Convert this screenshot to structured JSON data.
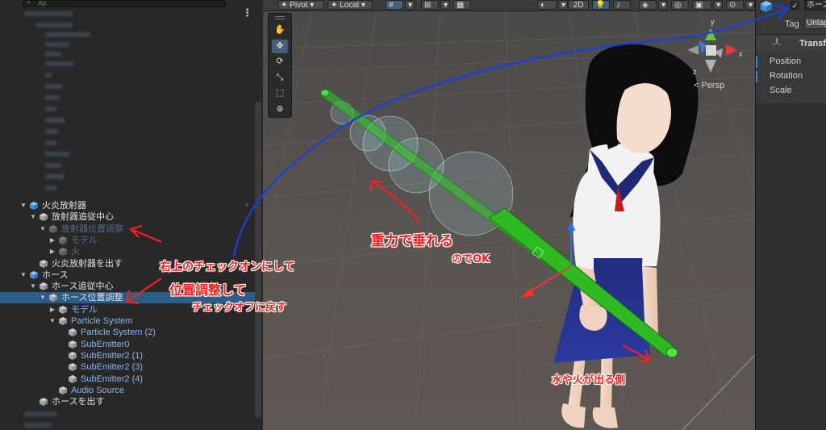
{
  "hierarchy": {
    "search_placeholder": "All",
    "items": [
      {
        "label": "火炎放射器",
        "level": 1,
        "expanded": true,
        "color": "white",
        "prefab": true
      },
      {
        "label": "放射器追従中心",
        "level": 2,
        "expanded": true,
        "color": "white"
      },
      {
        "label": "放射器位置調整",
        "level": 3,
        "expanded": true,
        "color": "dim"
      },
      {
        "label": "モデル",
        "level": 4,
        "expanded": false,
        "color": "dim"
      },
      {
        "label": "火",
        "level": 4,
        "expanded": false,
        "color": "dim"
      },
      {
        "label": "火炎放射器を出す",
        "level": 2,
        "expanded": null,
        "color": "white"
      },
      {
        "label": "ホース",
        "level": 1,
        "expanded": true,
        "color": "white",
        "prefab": true
      },
      {
        "label": "ホース追従中心",
        "level": 2,
        "expanded": true,
        "color": "white"
      },
      {
        "label": "ホース位置調整",
        "level": 3,
        "expanded": true,
        "color": "white",
        "selected": true
      },
      {
        "label": "モデル",
        "level": 4,
        "expanded": false,
        "color": "blue"
      },
      {
        "label": "Particle System",
        "level": 4,
        "expanded": true,
        "color": "blue"
      },
      {
        "label": "Particle System (2)",
        "level": 5,
        "expanded": null,
        "color": "blue"
      },
      {
        "label": "SubEmitter0",
        "level": 5,
        "expanded": null,
        "color": "blue"
      },
      {
        "label": "SubEmitter2 (1)",
        "level": 5,
        "expanded": null,
        "color": "blue"
      },
      {
        "label": "SubEmitter2 (3)",
        "level": 5,
        "expanded": null,
        "color": "blue"
      },
      {
        "label": "SubEmitter2 (4)",
        "level": 5,
        "expanded": null,
        "color": "blue"
      },
      {
        "label": "Audio Source",
        "level": 4,
        "expanded": null,
        "color": "blue"
      },
      {
        "label": "ホースを出す",
        "level": 2,
        "expanded": null,
        "color": "white"
      }
    ]
  },
  "scene": {
    "toolbar": {
      "pivot": "Pivot",
      "local": "Local",
      "mode_2d": "2D"
    },
    "tools": [
      "hand-tool",
      "move-tool",
      "rotate-tool",
      "scale-tool",
      "rect-tool",
      "transform-tool"
    ],
    "tool_glyphs": [
      "✋",
      "✥",
      "⟳",
      "⤡",
      "⬚",
      "⊛"
    ],
    "gizmo": {
      "x": "x",
      "y": "y",
      "z": "z",
      "projection": "< Persp"
    }
  },
  "inspector": {
    "object_name": "ホース",
    "tag_label": "Tag",
    "tag_value": "Untagged",
    "component": "Transform",
    "properties": [
      "Position",
      "Rotation",
      "Scale"
    ]
  },
  "annotations": {
    "note_topright": "右上のチェックオンにして",
    "note_adjust": "位置調整して",
    "note_checkoff": "チェックオフに戻す",
    "note_gravity": "重力で垂れる",
    "note_ok": "のでOK",
    "note_water": "水や火が出る側"
  },
  "colors": {
    "hierarchy_bg": "#282828",
    "selection": "#2c5d87",
    "scene_bg": "#3a3a3a",
    "hose": "#3fcc2a",
    "annotation_red": "#ff1e1e",
    "annotation_blue": "#1c3ddc"
  }
}
